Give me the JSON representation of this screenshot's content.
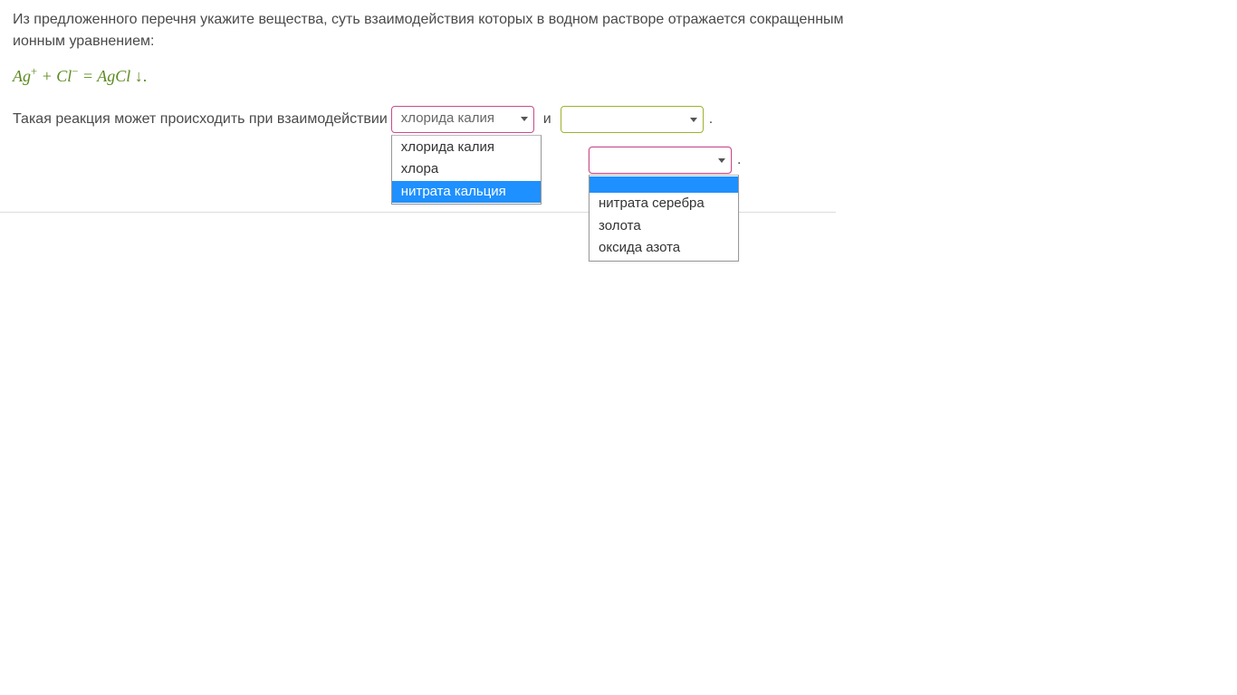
{
  "question": {
    "intro": "Из предложенного перечня укажите вещества, суть взаимодействия которых  в водном растворе отражается сокращенным ионным уравнением:",
    "equation_parts": {
      "ag": "Ag",
      "plus_sup": "+",
      "plus": " + ",
      "cl": "Cl",
      "minus_sup": "−",
      "eq": " = ",
      "agcl": "AgCl",
      "arrow": " ↓",
      "end": "."
    },
    "interaction_text": "Такая реакция может происходить при взаимодействии",
    "conjunction": "и"
  },
  "select1": {
    "selected": "хлорида калия",
    "options": [
      "хлорида калия",
      "хлора",
      "нитрата кальция"
    ],
    "highlighted_index": 2
  },
  "select2": {
    "selected": "",
    "options": [
      "",
      "нитрата серебра",
      "золота",
      "оксида азота"
    ],
    "highlighted_index": 0
  },
  "period": "."
}
